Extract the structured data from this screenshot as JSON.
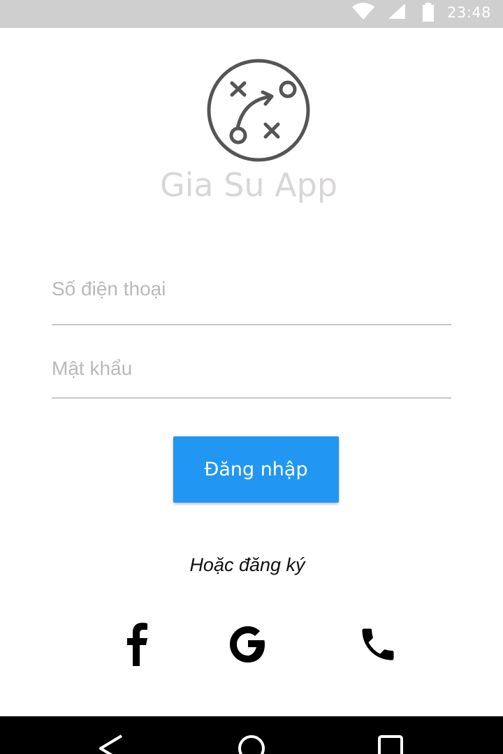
{
  "status_bar": {
    "time": "23:48",
    "icons": [
      "wifi-icon",
      "signal-icon",
      "battery-icon"
    ]
  },
  "app": {
    "title": "Gia Su App",
    "logo_icon": "strategy-play-icon",
    "logo_color": "#555555",
    "title_color": "#d9d6d6"
  },
  "form": {
    "phone": {
      "value": "",
      "placeholder": "Số điện thoại"
    },
    "password": {
      "value": "",
      "placeholder": "Mật khẩu"
    }
  },
  "login_button": {
    "label": "Đăng nhập",
    "color": "#2196f3"
  },
  "register_prompt": "Hoặc đăng ký",
  "social": [
    {
      "name": "facebook",
      "icon": "facebook-icon"
    },
    {
      "name": "google",
      "icon": "google-icon"
    },
    {
      "name": "phone",
      "icon": "phone-icon"
    }
  ],
  "nav_bar": {
    "icons": [
      "back-icon",
      "home-icon",
      "recents-icon"
    ]
  }
}
